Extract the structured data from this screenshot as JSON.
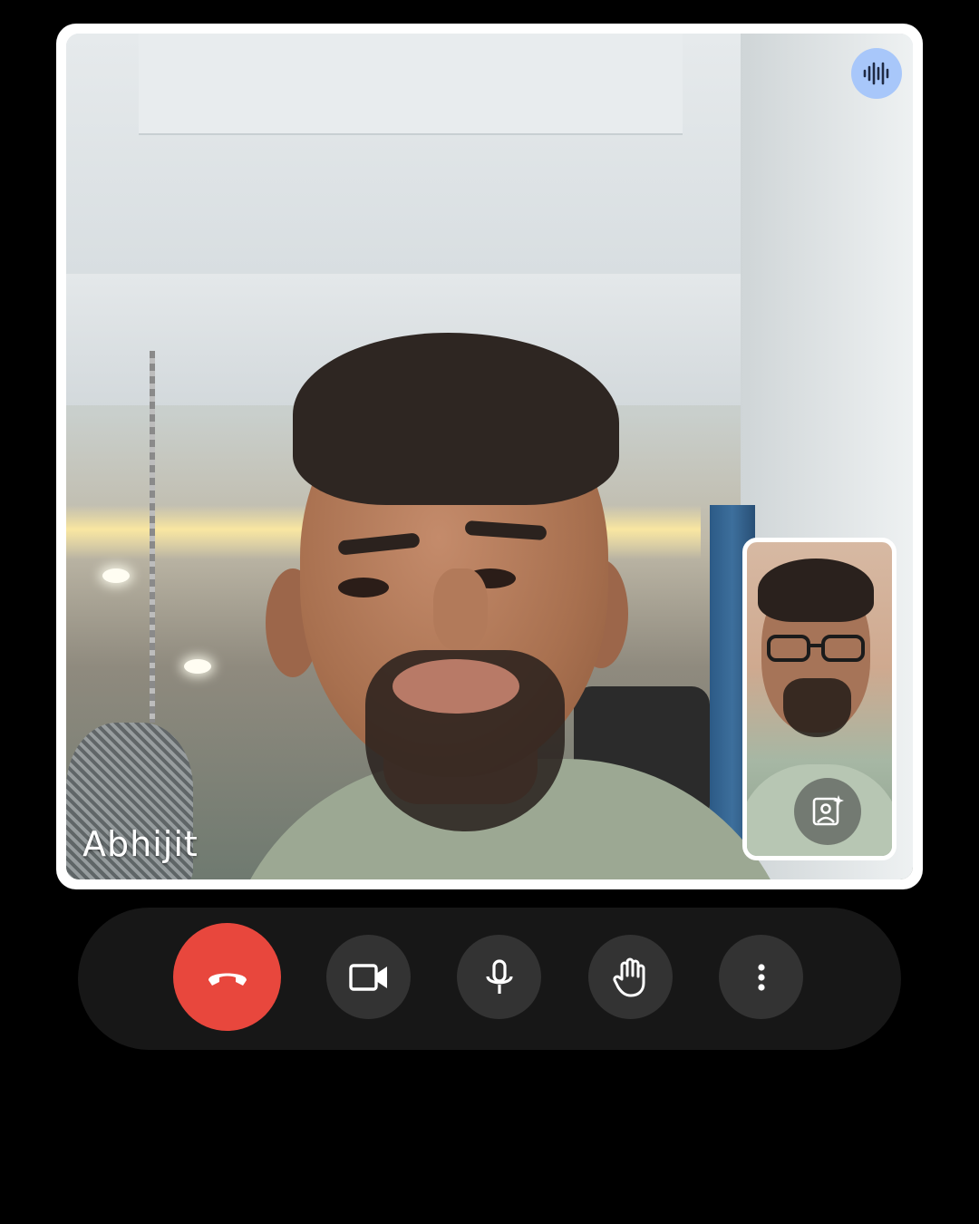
{
  "call": {
    "remote_participant_name": "Abhijit"
  },
  "icons": {
    "speaking": "audio-wave-icon",
    "effects": "portrait-sparkle-icon",
    "end_call": "phone-hangup-icon",
    "camera": "videocam-icon",
    "microphone": "mic-icon",
    "raise_hand": "hand-icon",
    "more": "more-vert-icon"
  },
  "colors": {
    "end_call": "#e8473d",
    "control_button": "#333333",
    "control_bar": "#171717",
    "speaking_indicator": "#a8c7fa"
  }
}
